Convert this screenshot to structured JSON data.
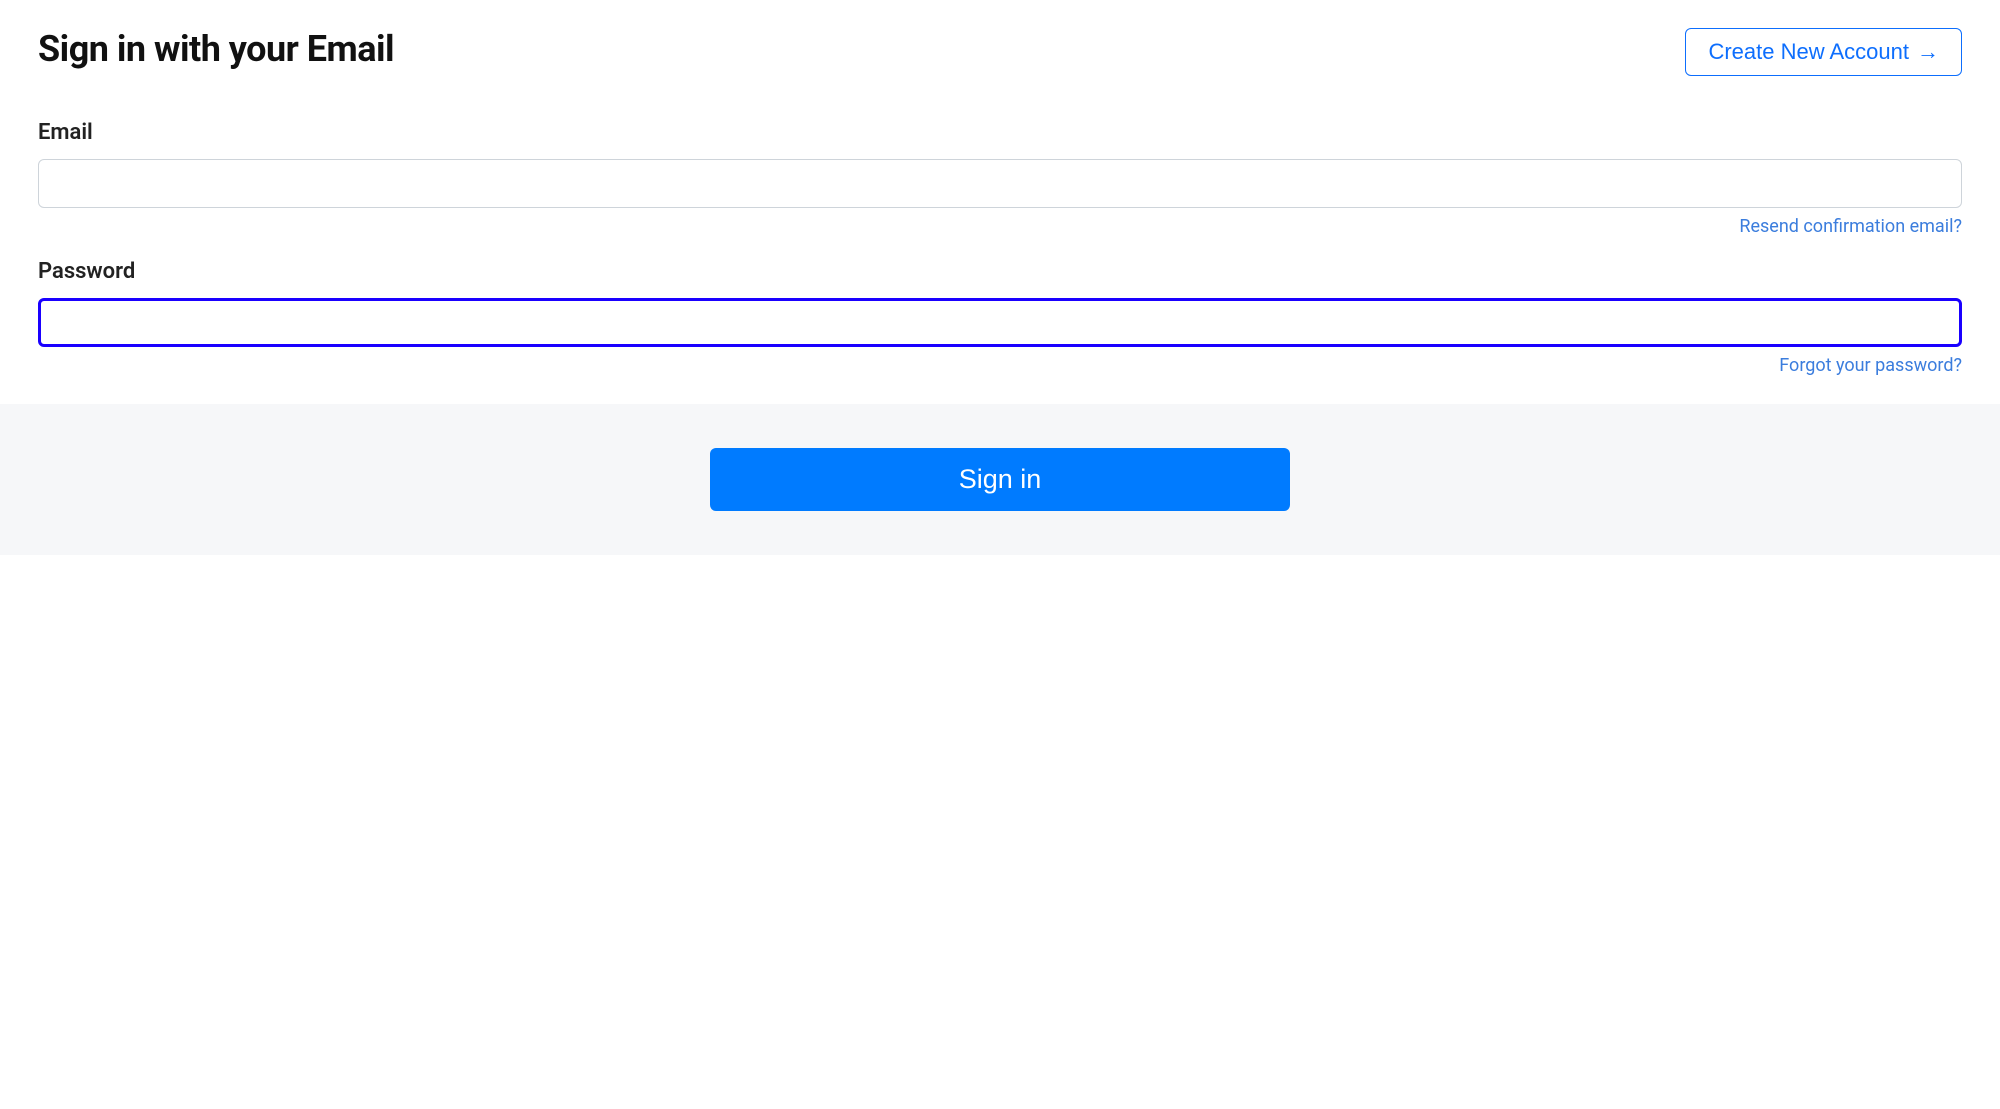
{
  "header": {
    "title": "Sign in with your Email",
    "create_account_label": "Create New Account"
  },
  "form": {
    "email": {
      "label": "Email",
      "value": "",
      "helper_link": "Resend confirmation email?"
    },
    "password": {
      "label": "Password",
      "value": "",
      "helper_link": "Forgot your password?"
    }
  },
  "footer": {
    "signin_label": "Sign in"
  }
}
